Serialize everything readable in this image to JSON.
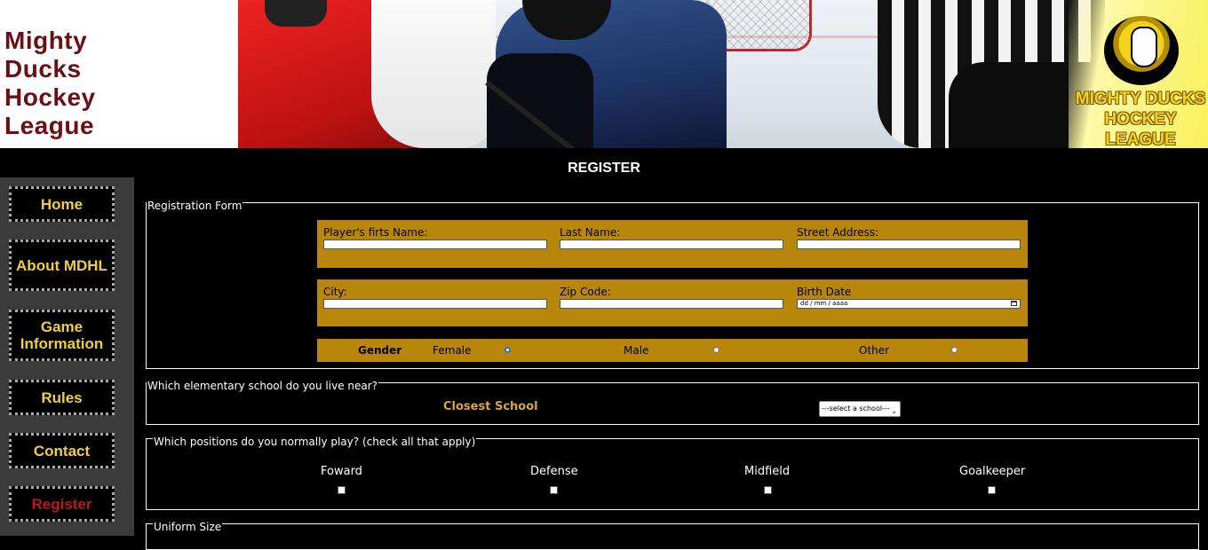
{
  "site": {
    "title_lines": [
      "Mighty",
      "Ducks",
      "Hockey",
      "League"
    ]
  },
  "banner": {
    "logo_line1": "MIGHTY DUCKS",
    "logo_line2": "HOCKEY LEAGUE"
  },
  "page": {
    "title": "REGISTER"
  },
  "nav": {
    "items": [
      {
        "label": "Home"
      },
      {
        "label": "About MDHL"
      },
      {
        "label": "Game Information"
      },
      {
        "label": "Rules"
      },
      {
        "label": "Contact"
      },
      {
        "label": "Register",
        "active": true
      }
    ]
  },
  "registration": {
    "legend": "Registration Form",
    "first_name_label": "Player's firts Name:",
    "last_name_label": "Last Name:",
    "street_label": "Street Address:",
    "city_label": "City:",
    "zip_label": "Zip Code:",
    "birth_label": "Birth Date",
    "birth_placeholder": "dd / mm / aaaa",
    "gender_label": "Gender",
    "gender_options": [
      "Female",
      "Male",
      "Other"
    ],
    "gender_selected": "Female"
  },
  "school": {
    "legend": "Which elementary school do you live near?",
    "label": "Closest School",
    "select_value": "---select a school---"
  },
  "positions": {
    "legend": "Which positions do you normally play? (check all that apply)",
    "options": [
      "Foward",
      "Defense",
      "Midfield",
      "Goalkeeper"
    ]
  },
  "uniform": {
    "legend": "Uniform Size"
  },
  "colors": {
    "title_maroon": "#6b0f14",
    "nav_gold": "#f2cf3a",
    "nav_active_red": "#b51c1c",
    "form_gold": "#b8860b",
    "school_label_gold": "#d9a63f",
    "sidebar_gray": "#3b3b3b"
  }
}
